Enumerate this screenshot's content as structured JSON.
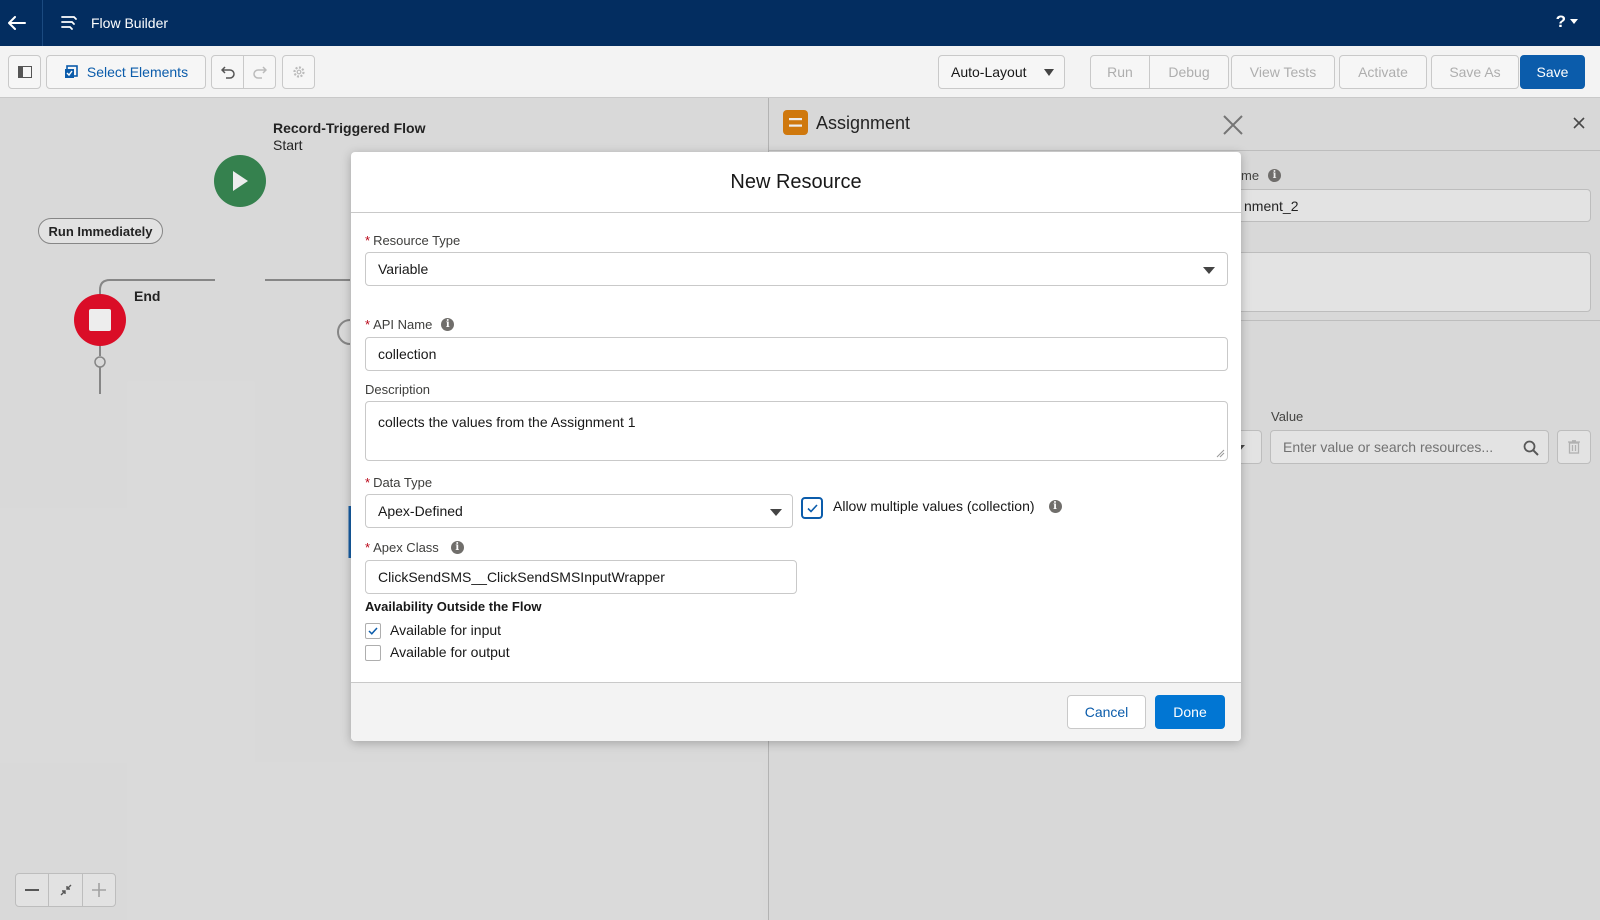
{
  "topbar": {
    "app_title": "Flow Builder",
    "help_glyph": "?"
  },
  "toolbar": {
    "select_elements": "Select Elements",
    "layout_mode": "Auto-Layout",
    "run": "Run",
    "debug": "Debug",
    "view_tests": "View Tests",
    "activate": "Activate",
    "save_as": "Save As",
    "save": "Save"
  },
  "canvas": {
    "start_title": "Record-Triggered Flow",
    "start_subtitle": "Start",
    "run_immediately": "Run Immediately",
    "end_label": "End"
  },
  "panel": {
    "title": "Assignment",
    "name_label_partial": "me",
    "name_value_partial": "nment_2",
    "value_label": "Value",
    "value_placeholder": "Enter value or search resources..."
  },
  "modal": {
    "title": "New Resource",
    "resource_type_label": "Resource Type",
    "resource_type_value": "Variable",
    "api_name_label": "API Name",
    "api_name_value": "collection",
    "description_label": "Description",
    "description_value": "collects the values from the Assignment 1",
    "data_type_label": "Data Type",
    "data_type_value": "Apex-Defined",
    "allow_multiple_label": "Allow multiple values (collection)",
    "allow_multiple_checked": true,
    "apex_class_label": "Apex Class",
    "apex_class_value": "ClickSendSMS__ClickSendSMSInputWrapper",
    "availability_heading": "Availability Outside the Flow",
    "available_input_label": "Available for input",
    "available_input_checked": true,
    "available_output_label": "Available for output",
    "available_output_checked": false,
    "cancel_label": "Cancel",
    "done_label": "Done"
  },
  "colors": {
    "header_navy": "#032d60",
    "brand_blue": "#0b5cab",
    "start_green": "#2e844a",
    "end_red": "#ea001e",
    "assignment_orange": "#dd7a01",
    "required_red": "#ba0517"
  }
}
